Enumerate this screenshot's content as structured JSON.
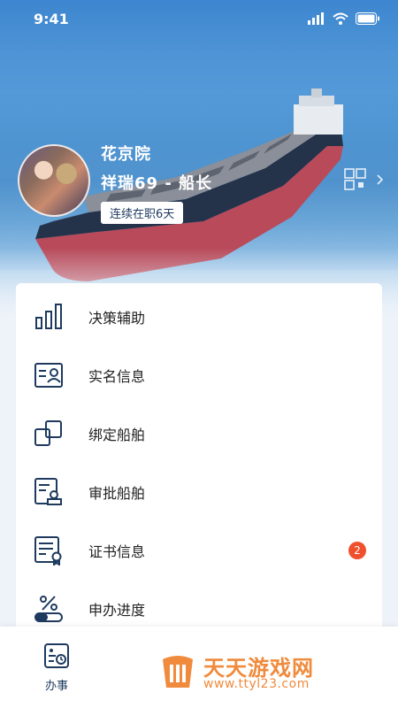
{
  "status_bar": {
    "time": "9:41"
  },
  "profile": {
    "name": "花京院",
    "ship_role": "祥瑞69 - 船长",
    "tenure": "连续在职6天"
  },
  "menu": [
    {
      "label": "决策辅助",
      "icon": "bar-chart-icon"
    },
    {
      "label": "实名信息",
      "icon": "id-card-icon"
    },
    {
      "label": "绑定船舶",
      "icon": "link-squares-icon"
    },
    {
      "label": "审批船舶",
      "icon": "approve-stamp-icon"
    },
    {
      "label": "证书信息",
      "icon": "certificate-icon",
      "badge": "2"
    },
    {
      "label": "申办进度",
      "icon": "progress-percent-icon"
    }
  ],
  "tabbar": {
    "items": [
      {
        "label": "办事",
        "icon": "services-icon"
      }
    ]
  },
  "watermark": {
    "title": "天天游戏网",
    "url": "www.ttyl23.com"
  },
  "colors": {
    "accent": "#1e3a5f",
    "badge": "#f0502e",
    "watermark": "#f08a3c"
  }
}
